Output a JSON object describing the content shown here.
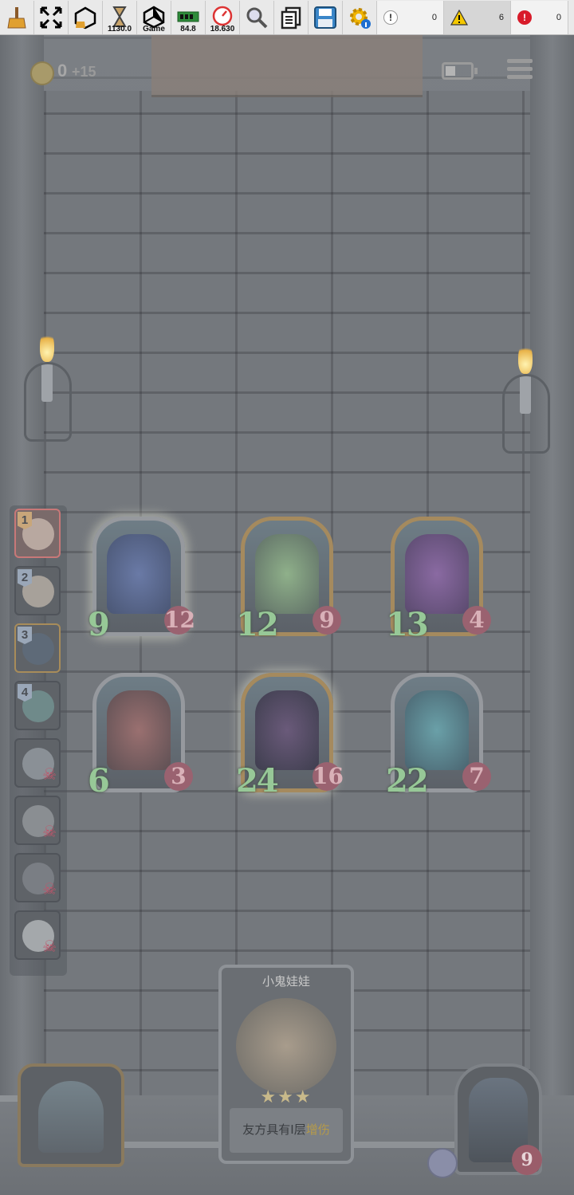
{
  "toolbar": {
    "timescale_value": "1130.0",
    "game_label": "Game",
    "memory_value": "84.8",
    "frame_value": "18.630",
    "info_count": "0",
    "warning_count": "6",
    "error_count": "0"
  },
  "hud": {
    "coins": "0",
    "coins_bonus": "+15"
  },
  "roster": [
    {
      "num": "1",
      "state": "active"
    },
    {
      "num": "2",
      "state": "alive"
    },
    {
      "num": "3",
      "state": "alive"
    },
    {
      "num": "4",
      "state": "alive"
    },
    {
      "num": "",
      "state": "dead"
    },
    {
      "num": "",
      "state": "dead"
    },
    {
      "num": "",
      "state": "dead"
    },
    {
      "num": "",
      "state": "dead"
    }
  ],
  "cards": [
    {
      "attack": "9",
      "health": "12",
      "portrait": "blue-crystal-dragon"
    },
    {
      "attack": "12",
      "health": "9",
      "portrait": "green-croc-egg"
    },
    {
      "attack": "13",
      "health": "4",
      "portrait": "purple-dragon"
    },
    {
      "attack": "6",
      "health": "3",
      "portrait": "armored-knight"
    },
    {
      "attack": "24",
      "health": "16",
      "portrait": "shadow-dragon"
    },
    {
      "attack": "22",
      "health": "7",
      "portrait": "blue-rabbit-monster"
    }
  ],
  "featured": {
    "name": "小鬼娃娃",
    "stars": "★★★",
    "desc_prefix": "友方具有I层",
    "desc_highlight": "增伤"
  },
  "player": {
    "health": "9"
  }
}
